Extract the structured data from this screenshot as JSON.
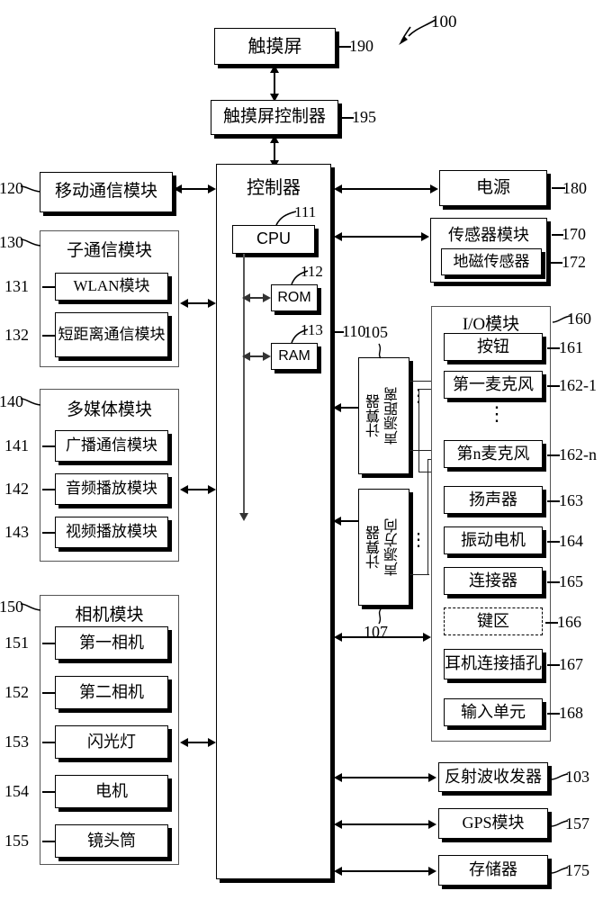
{
  "figure": {
    "number": "100"
  },
  "top": {
    "touch_screen": {
      "label": "触摸屏",
      "ref": "190"
    },
    "touch_screen_controller": {
      "label": "触摸屏控制器",
      "ref": "195"
    }
  },
  "controller": {
    "label": "控制器",
    "ref": "110",
    "cpu": {
      "label": "CPU",
      "ref": "111"
    },
    "rom": {
      "label": "ROM",
      "ref": "112"
    },
    "ram": {
      "label": "RAM",
      "ref": "113"
    }
  },
  "left_column": {
    "mobile_comm": {
      "label": "移动通信模块",
      "ref": "120"
    },
    "sub_comm": {
      "label": "子通信模块",
      "ref": "130",
      "items": [
        {
          "label": "WLAN模块",
          "ref": "131"
        },
        {
          "label": "短距离通信模块",
          "ref": "132"
        }
      ]
    },
    "multimedia": {
      "label": "多媒体模块",
      "ref": "140",
      "items": [
        {
          "label": "广播通信模块",
          "ref": "141"
        },
        {
          "label": "音频播放模块",
          "ref": "142"
        },
        {
          "label": "视频播放模块",
          "ref": "143"
        }
      ]
    },
    "camera": {
      "label": "相机模块",
      "ref": "150",
      "items": [
        {
          "label": "第一相机",
          "ref": "151"
        },
        {
          "label": "第二相机",
          "ref": "152"
        },
        {
          "label": "闪光灯",
          "ref": "153"
        },
        {
          "label": "电机",
          "ref": "154"
        },
        {
          "label": "镜头筒",
          "ref": "155"
        }
      ]
    }
  },
  "calculators": {
    "distance": {
      "label_a": "声源距离",
      "label_b": "计算器",
      "ref": "105"
    },
    "direction": {
      "label_a": "声源方向",
      "label_b": "计算器",
      "ref": "107"
    }
  },
  "right_column": {
    "power": {
      "label": "电源",
      "ref": "180"
    },
    "sensor_module": {
      "label": "传感器模块",
      "ref": "170",
      "items": [
        {
          "label": "地磁传感器",
          "ref": "172"
        }
      ]
    },
    "io_module": {
      "label": "I/O模块",
      "ref": "160",
      "items": [
        {
          "label": "按钮",
          "ref": "161",
          "dashed": false
        },
        {
          "label": "第一麦克风",
          "ref": "162-1",
          "dashed": false
        },
        {
          "label": "第n麦克风",
          "ref": "162-n",
          "dashed": false
        },
        {
          "label": "扬声器",
          "ref": "163",
          "dashed": false
        },
        {
          "label": "振动电机",
          "ref": "164",
          "dashed": false
        },
        {
          "label": "连接器",
          "ref": "165",
          "dashed": false
        },
        {
          "label": "键区",
          "ref": "166",
          "dashed": true
        },
        {
          "label": "耳机连接插孔",
          "ref": "167",
          "dashed": false
        },
        {
          "label": "输入单元",
          "ref": "168",
          "dashed": false
        }
      ]
    },
    "reflected_wave": {
      "label": "反射波收发器",
      "ref": "103"
    },
    "gps": {
      "label": "GPS模块",
      "ref": "157"
    },
    "storage": {
      "label": "存储器",
      "ref": "175"
    }
  },
  "ellipsis": {
    "glyph": "⋮"
  }
}
